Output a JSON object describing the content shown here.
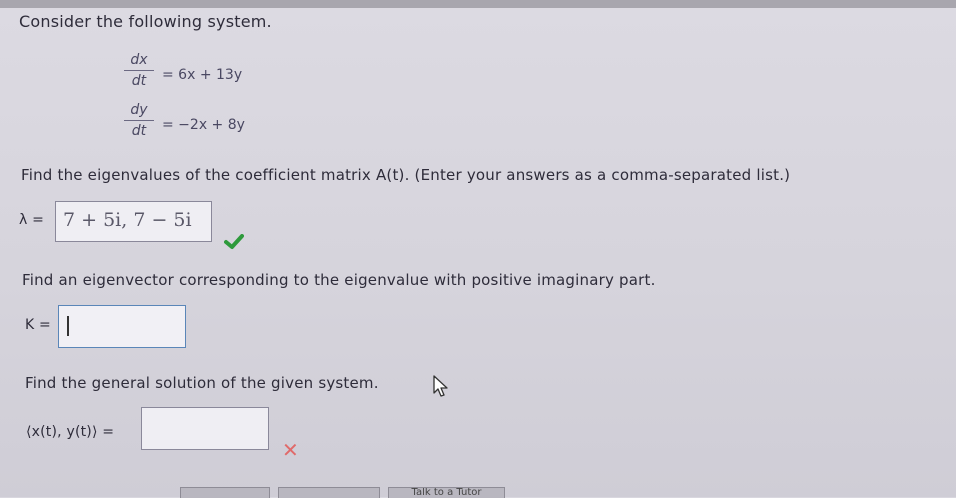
{
  "prompt": "Consider the following system.",
  "system": {
    "eq1": {
      "num": "dx",
      "den": "dt",
      "rhs": "= 6x + 13y"
    },
    "eq2": {
      "num": "dy",
      "den": "dt",
      "rhs": "= −2x + 8y"
    }
  },
  "q1": {
    "text": "Find the eigenvalues of the coefficient matrix A(t). (Enter your answers as a comma-separated list.)",
    "label": "λ =",
    "value": "7 + 5i, 7 − 5i",
    "status": "correct"
  },
  "q2": {
    "text": "Find an eigenvector corresponding to the eigenvalue with positive imaginary part.",
    "label": "K =",
    "value": ""
  },
  "q3": {
    "text": "Find the general solution of the given system.",
    "label": "⟨x(t), y(t)⟩ =",
    "value": "",
    "status": "incorrect"
  },
  "footer": {
    "btn3": "Talk to a Tutor"
  },
  "colors": {
    "correct": "#2e9a3c",
    "incorrect": "#e06a6a",
    "focus_border": "#5a86b8"
  }
}
